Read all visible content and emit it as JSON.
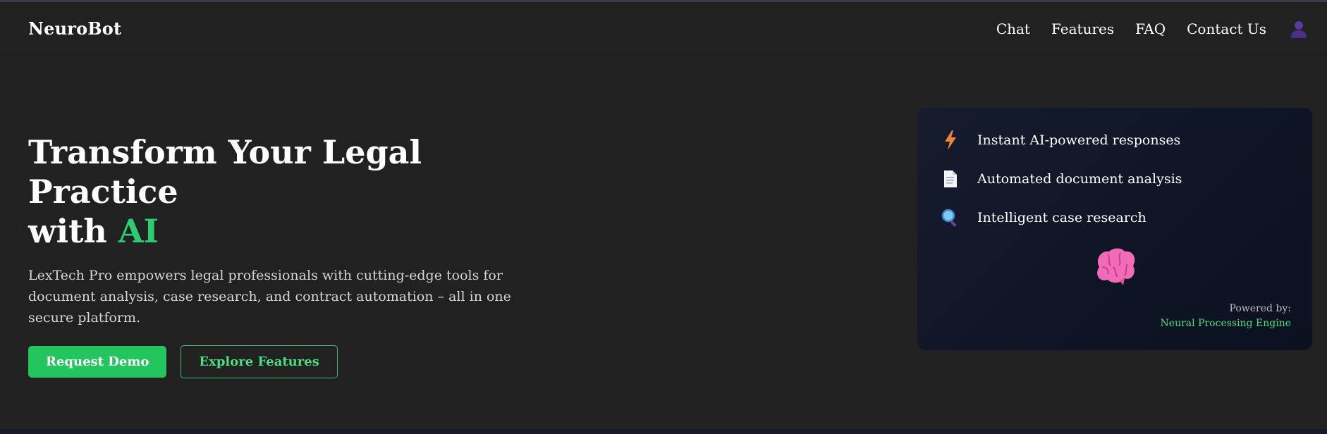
{
  "navbar": {
    "brand": "NeuroBot",
    "links": [
      "Chat",
      "Features",
      "FAQ",
      "Contact Us"
    ],
    "user_icon": "user-avatar-icon"
  },
  "hero": {
    "title_line1": "Transform Your Legal Practice",
    "title_line2_prefix": "with ",
    "title_accent": "AI",
    "description": "LexTech Pro empowers legal professionals with cutting-edge tools for document analysis, case research, and contract automation – all in one secure platform.",
    "primary_button": "Request Demo",
    "secondary_button": "Explore Features"
  },
  "feature_card": {
    "items": [
      {
        "icon": "lightning-icon",
        "text": "Instant AI-powered responses"
      },
      {
        "icon": "document-icon",
        "text": "Automated document analysis"
      },
      {
        "icon": "magnifier-icon",
        "text": "Intelligent case research"
      }
    ],
    "center_icon": "brain-icon",
    "powered_label": "Powered by:",
    "powered_engine": "Neural Processing Engine"
  },
  "colors": {
    "background": "#212121",
    "accent": "#22c55e",
    "accent_text": "#2ecc71",
    "card_background": "#0f1526"
  }
}
